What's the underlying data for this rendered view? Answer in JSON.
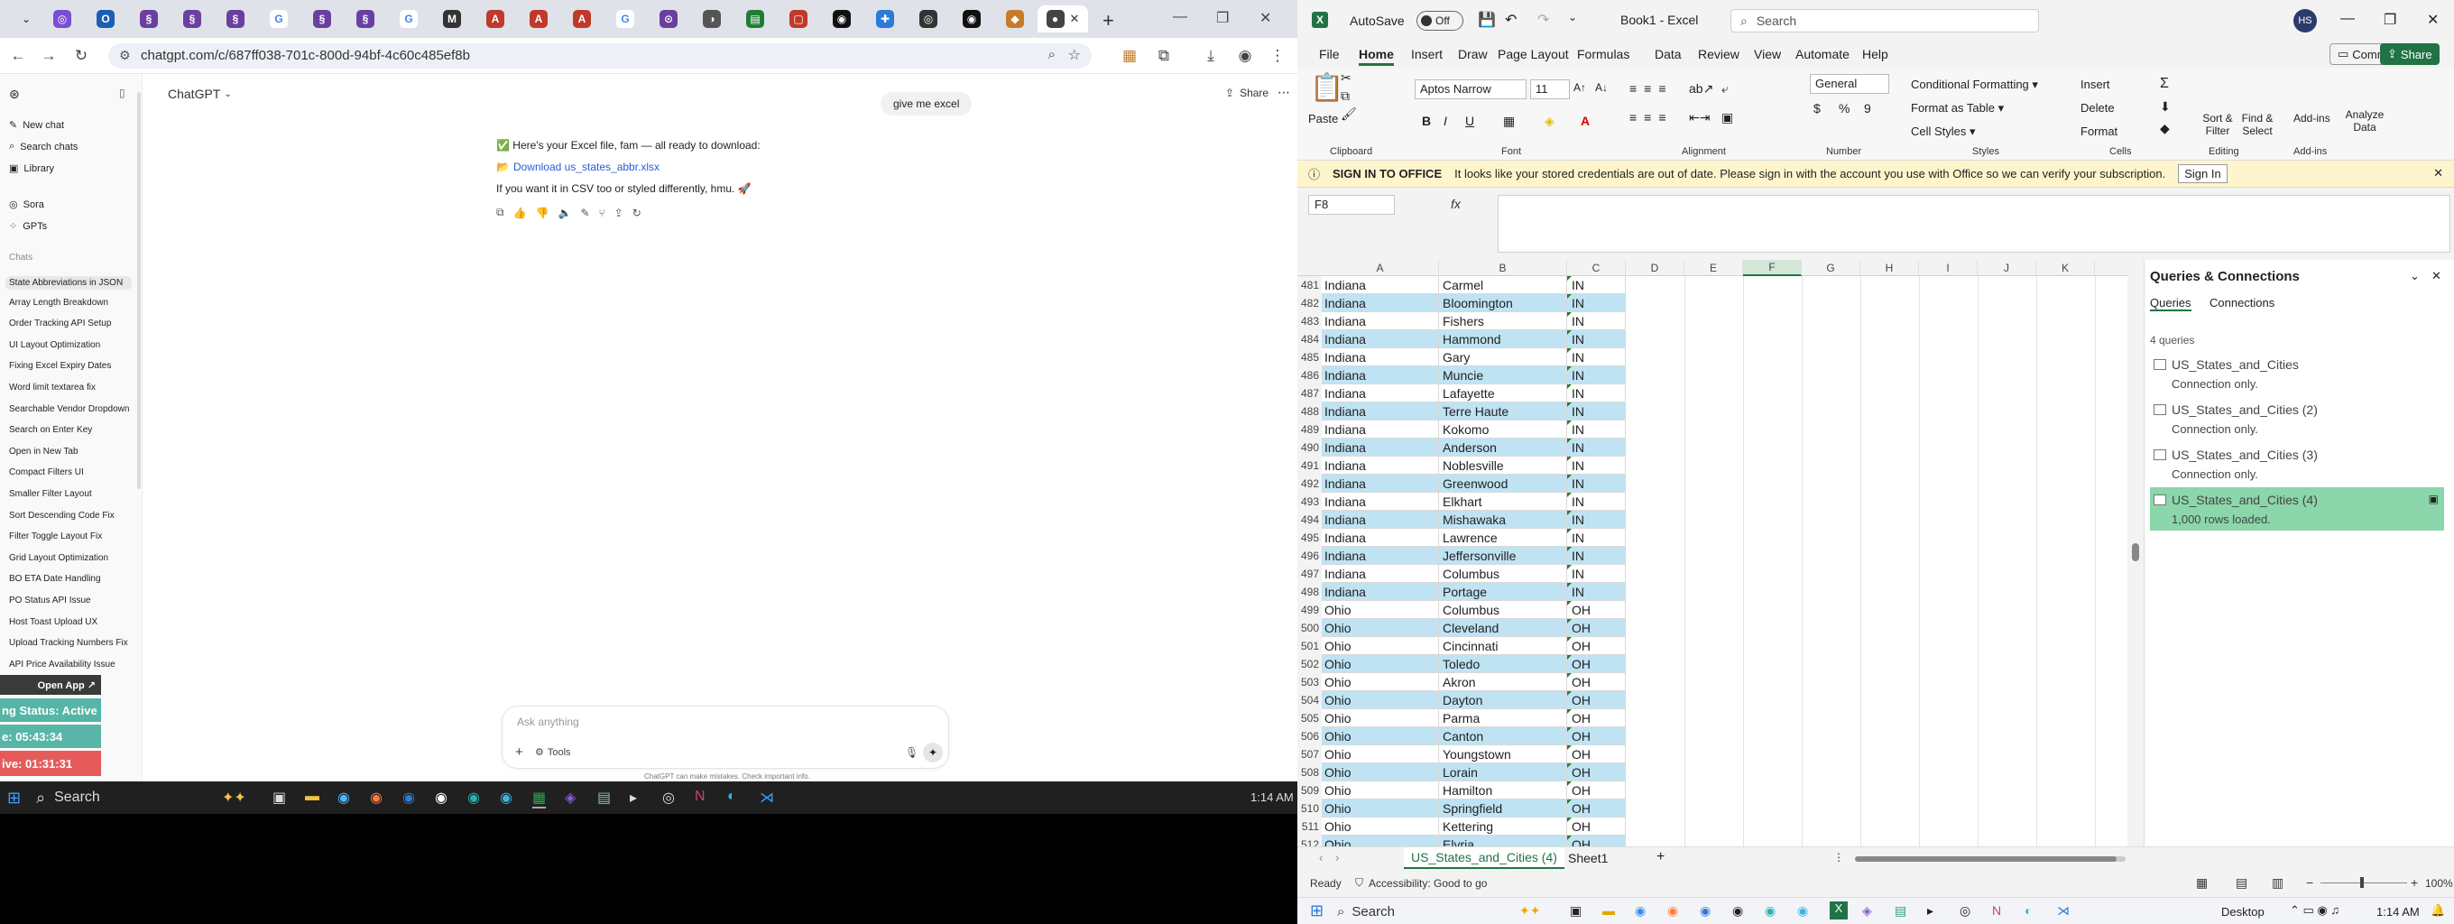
{
  "browser": {
    "url": "chatgpt.com/c/687ff038-701c-800d-94bf-4c60c485ef8b",
    "new_tab_label": "+",
    "close_tab_glyph": "✕"
  },
  "chatgpt": {
    "model": "ChatGPT",
    "share_label": "Share",
    "nav": [
      {
        "label": "New chat",
        "icon": "edit-icon"
      },
      {
        "label": "Search chats",
        "icon": "search-icon"
      },
      {
        "label": "Library",
        "icon": "library-icon"
      },
      {
        "label": "Sora",
        "icon": "sora-icon"
      },
      {
        "label": "GPTs",
        "icon": "gpts-icon"
      }
    ],
    "chats_header": "Chats",
    "chats": [
      "State Abbreviations in JSON",
      "Array Length Breakdown",
      "Order Tracking API Setup",
      "UI Layout Optimization",
      "Fixing Excel Expiry Dates",
      "Word limit textarea fix",
      "Searchable Vendor Dropdown",
      "Search on Enter Key",
      "Open in New Tab",
      "Compact Filters UI",
      "Smaller Filter Layout",
      "Sort Descending Code Fix",
      "Filter Toggle Layout Fix",
      "Grid Layout Optimization",
      "BO ETA Date Handling",
      "PO Status API Issue",
      "Host Toast Upload UX",
      "Upload Tracking Numbers Fix",
      "API Price Availability Issue"
    ],
    "user_message": "give me excel",
    "assistant_line1": "✅ Here's your Excel file, fam — all ready to download:",
    "assistant_link": "Download us_states_abbr.xlsx",
    "assistant_line3": "If you want it in CSV too or styled differently, hmu. 🚀",
    "input_placeholder": "Ask anything",
    "tools_label": "Tools",
    "disclaimer": "ChatGPT can make mistakes. Check important info."
  },
  "overlay": {
    "open_app": "Open App ↗",
    "status": "ng Status: Active",
    "timer1": "e: 05:43:34",
    "timer2": "ive: 01:31:31"
  },
  "taskbar_left": {
    "search": "Search",
    "time": "1:14 AM"
  },
  "excel": {
    "autosave": "AutoSave",
    "autosave_state": "Off",
    "title": "Book1 - Excel",
    "search": "Search",
    "user_initials": "HS",
    "menu": [
      "File",
      "Home",
      "Insert",
      "Draw",
      "Page Layout",
      "Formulas",
      "Data",
      "Review",
      "View",
      "Automate",
      "Help"
    ],
    "comments": "Comments",
    "share": "Share",
    "font_name": "Aptos Narrow",
    "font_size": "11",
    "number_format": "General",
    "groups": [
      "Clipboard",
      "Font",
      "Alignment",
      "Number",
      "Styles",
      "Cells",
      "Editing",
      "Add-ins"
    ],
    "styles": [
      "Conditional Formatting ▾",
      "Format as Table ▾",
      "Cell Styles ▾"
    ],
    "cells": [
      "Insert",
      "Delete",
      "Format"
    ],
    "editing": [
      "Sort & Filter",
      "Find & Select"
    ],
    "addins": [
      "Add-ins",
      "Analyze Data"
    ],
    "paste": "Paste",
    "msg_title": "SIGN IN TO OFFICE",
    "msg_text": "It looks like your stored credentials are out of date. Please sign in with the account you use with Office so we can verify your subscription.",
    "sign_in": "Sign In",
    "name_box": "F8",
    "fx": "fx",
    "columns": [
      "A",
      "B",
      "C",
      "D",
      "E",
      "F",
      "G",
      "H",
      "I",
      "J",
      "K"
    ],
    "rows": [
      [
        "481",
        "Indiana",
        "Carmel",
        "IN"
      ],
      [
        "482",
        "Indiana",
        "Bloomington",
        "IN"
      ],
      [
        "483",
        "Indiana",
        "Fishers",
        "IN"
      ],
      [
        "484",
        "Indiana",
        "Hammond",
        "IN"
      ],
      [
        "485",
        "Indiana",
        "Gary",
        "IN"
      ],
      [
        "486",
        "Indiana",
        "Muncie",
        "IN"
      ],
      [
        "487",
        "Indiana",
        "Lafayette",
        "IN"
      ],
      [
        "488",
        "Indiana",
        "Terre Haute",
        "IN"
      ],
      [
        "489",
        "Indiana",
        "Kokomo",
        "IN"
      ],
      [
        "490",
        "Indiana",
        "Anderson",
        "IN"
      ],
      [
        "491",
        "Indiana",
        "Noblesville",
        "IN"
      ],
      [
        "492",
        "Indiana",
        "Greenwood",
        "IN"
      ],
      [
        "493",
        "Indiana",
        "Elkhart",
        "IN"
      ],
      [
        "494",
        "Indiana",
        "Mishawaka",
        "IN"
      ],
      [
        "495",
        "Indiana",
        "Lawrence",
        "IN"
      ],
      [
        "496",
        "Indiana",
        "Jeffersonville",
        "IN"
      ],
      [
        "497",
        "Indiana",
        "Columbus",
        "IN"
      ],
      [
        "498",
        "Indiana",
        "Portage",
        "IN"
      ],
      [
        "499",
        "Ohio",
        "Columbus",
        "OH"
      ],
      [
        "500",
        "Ohio",
        "Cleveland",
        "OH"
      ],
      [
        "501",
        "Ohio",
        "Cincinnati",
        "OH"
      ],
      [
        "502",
        "Ohio",
        "Toledo",
        "OH"
      ],
      [
        "503",
        "Ohio",
        "Akron",
        "OH"
      ],
      [
        "504",
        "Ohio",
        "Dayton",
        "OH"
      ],
      [
        "505",
        "Ohio",
        "Parma",
        "OH"
      ],
      [
        "506",
        "Ohio",
        "Canton",
        "OH"
      ],
      [
        "507",
        "Ohio",
        "Youngstown",
        "OH"
      ],
      [
        "508",
        "Ohio",
        "Lorain",
        "OH"
      ],
      [
        "509",
        "Ohio",
        "Hamilton",
        "OH"
      ],
      [
        "510",
        "Ohio",
        "Springfield",
        "OH"
      ],
      [
        "511",
        "Ohio",
        "Kettering",
        "OH"
      ],
      [
        "512",
        "Ohio",
        "Elyria",
        "OH"
      ]
    ],
    "queries": {
      "title": "Queries & Connections",
      "tabs": [
        "Queries",
        "Connections"
      ],
      "count": "4 queries",
      "items": [
        {
          "name": "US_States_and_Cities",
          "status": "Connection only."
        },
        {
          "name": "US_States_and_Cities (2)",
          "status": "Connection only."
        },
        {
          "name": "US_States_and_Cities (3)",
          "status": "Connection only."
        },
        {
          "name": "US_States_and_Cities (4)",
          "status": "1,000 rows loaded."
        }
      ]
    },
    "sheets": [
      "US_States_and_Cities (4)",
      "Sheet1"
    ],
    "status_ready": "Ready",
    "accessibility": "Accessibility: Good to go",
    "zoom": "100%"
  },
  "taskbar_right": {
    "search": "Search",
    "desktop": "Desktop",
    "time": "1:14 AM"
  },
  "colors": {
    "band": "#bfe3f3",
    "excel_green": "#217346",
    "query_selected": "#8bd6ab"
  }
}
